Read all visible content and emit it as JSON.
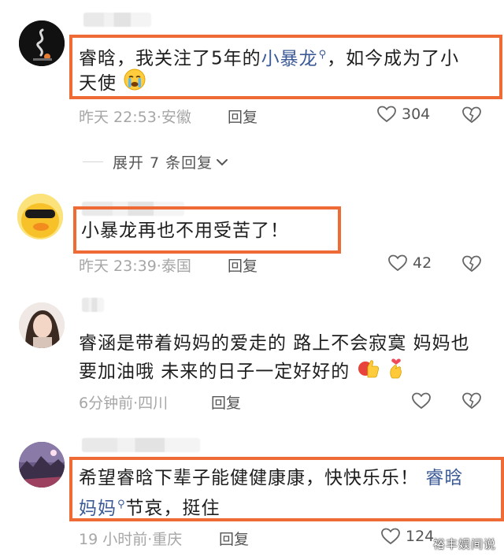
{
  "comments": [
    {
      "text_before": "睿晗，我关注了5年的",
      "mention": "小暴龙",
      "text_after": "，如今成为了小",
      "text_line2": "天使",
      "time": "昨天 22:53",
      "location": "安徽",
      "reply": "回复",
      "likes": "304",
      "emoji": "crying-face"
    },
    {
      "text": "小暴龙再也不用受苦了！",
      "time": "昨天 23:39",
      "location": "泰国",
      "reply": "回复",
      "likes": "42"
    },
    {
      "text_line1": "睿涵是带着妈妈的爱走的 路上不会寂寞 妈妈也",
      "text_line2": "要加油哦 未来的日子一定好好的",
      "time": "6分钟前",
      "location": "四川",
      "reply": "回复",
      "emoji": [
        "thumbs-up",
        "finger-heart"
      ]
    },
    {
      "text_line1": "希望睿晗下辈子能健健康康，快快乐乐！",
      "mention_line1": "睿晗",
      "mention_line2": "妈妈",
      "text_line2": "节哀，挺住",
      "time": "19 小时前",
      "location": "重庆",
      "reply": "回复",
      "likes": "124"
    }
  ],
  "expand_replies": "展开 7 条回复",
  "watermark": "裕丰娱间说",
  "colors": {
    "highlight": "#ef6b36",
    "mention": "#3b5a96",
    "meta": "#a6a6a6"
  }
}
